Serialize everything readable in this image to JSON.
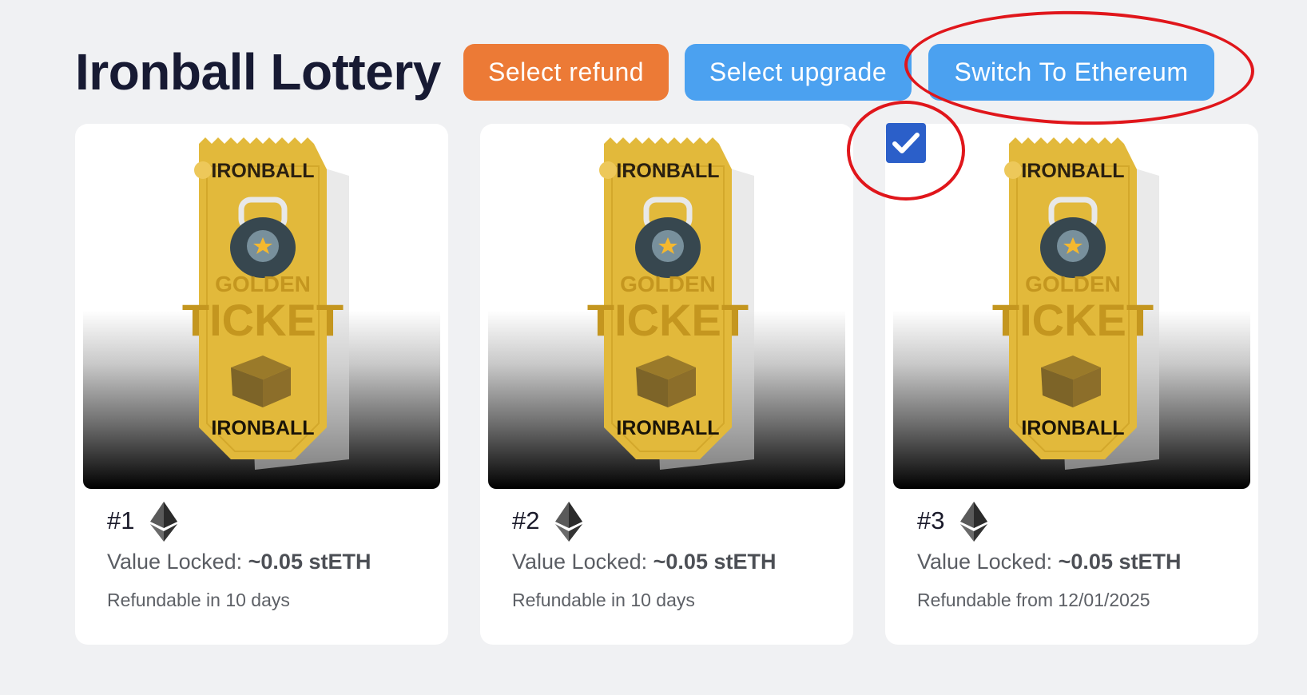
{
  "page": {
    "title": "Ironball Lottery"
  },
  "toolbar": {
    "refund_label": "Select refund",
    "upgrade_label": "Select upgrade",
    "switch_label": "Switch To Ethereum"
  },
  "colors": {
    "refund_button": "#ec7a36",
    "primary_button": "#4ba1f0",
    "checkbox": "#2b5fc9",
    "annotation": "#e0161b",
    "ticket_gold": "#e2b93b"
  },
  "ticket_art": {
    "top_text": "IRONBALL",
    "line1": "GOLDEN",
    "line2": "TICKET",
    "bottom_text": "IRONBALL"
  },
  "cards": [
    {
      "number": "#1",
      "network_icon": "ethereum-icon",
      "value_label": "Value Locked:",
      "value_amount": "~0.05 stETH",
      "refund_text": "Refundable in 10 days",
      "selected": false
    },
    {
      "number": "#2",
      "network_icon": "ethereum-icon",
      "value_label": "Value Locked:",
      "value_amount": "~0.05 stETH",
      "refund_text": "Refundable in 10 days",
      "selected": false
    },
    {
      "number": "#3",
      "network_icon": "ethereum-icon",
      "value_label": "Value Locked:",
      "value_amount": "~0.05 stETH",
      "refund_text": "Refundable from 12/01/2025",
      "selected": true
    }
  ]
}
